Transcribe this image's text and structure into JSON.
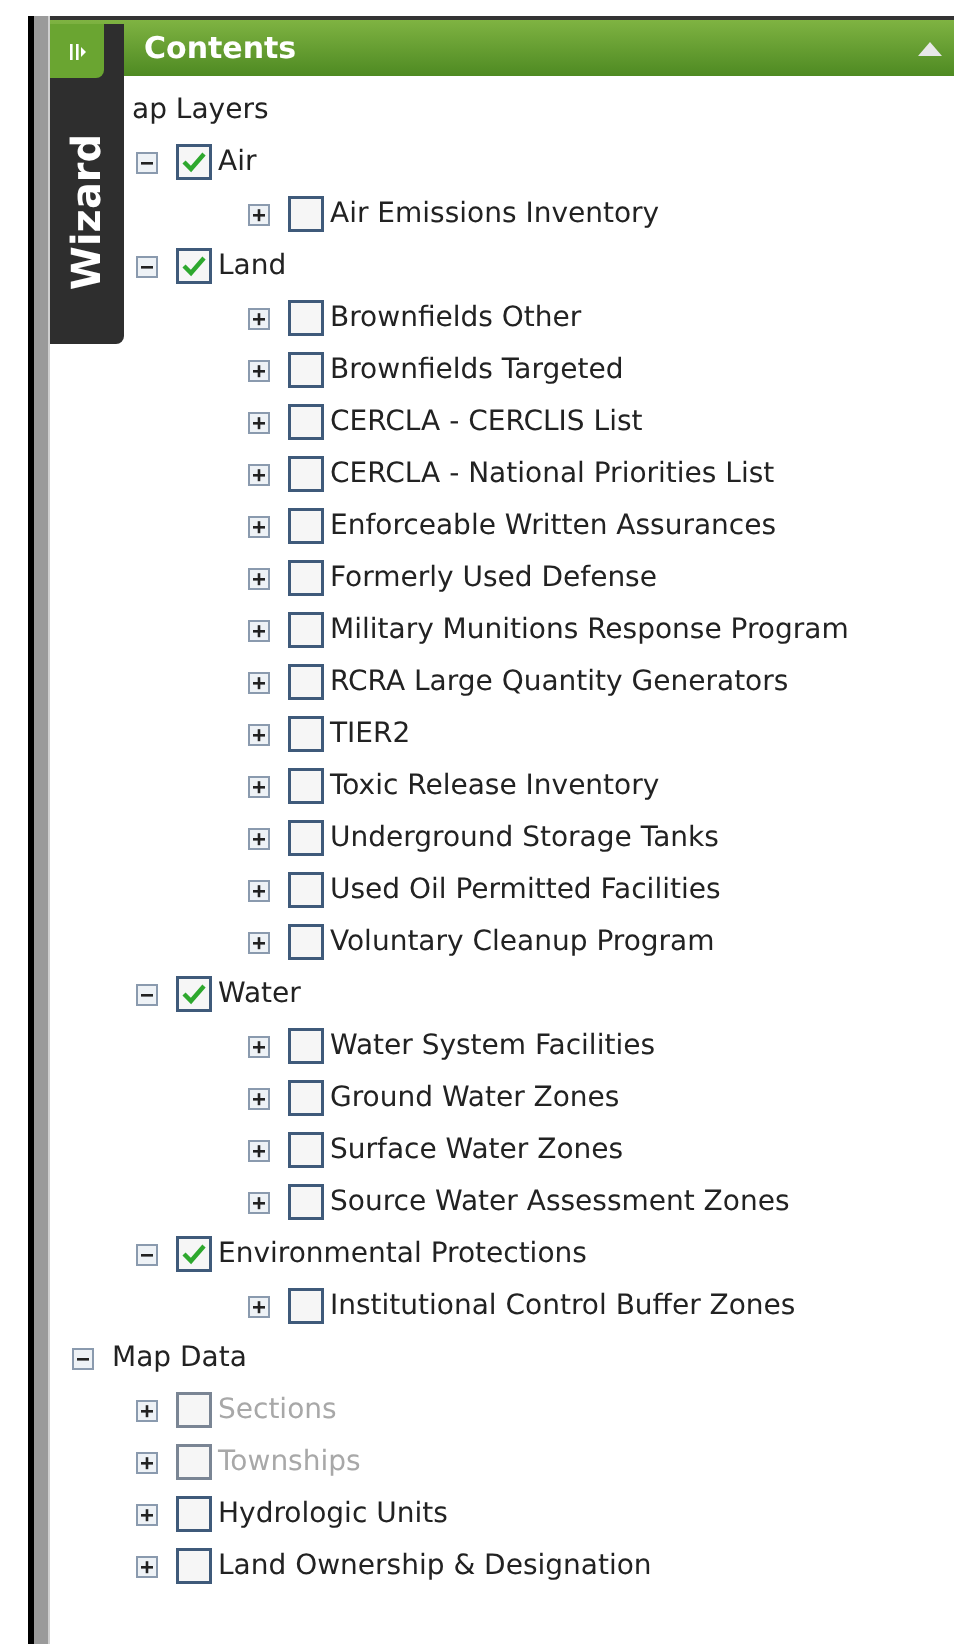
{
  "panel": {
    "title": "Contents"
  },
  "wizard": {
    "label": "Wizard"
  },
  "tree": [
    {
      "label": "ap Layers",
      "children": [
        {
          "label": "Air",
          "expanded": true,
          "checked": true,
          "disabled": false,
          "children": [
            {
              "label": "Air Emissions Inventory",
              "expanded": false,
              "checked": false,
              "disabled": false
            }
          ]
        },
        {
          "label": "Land",
          "expanded": true,
          "checked": true,
          "disabled": false,
          "children": [
            {
              "label": "Brownfields Other",
              "expanded": false,
              "checked": false,
              "disabled": false
            },
            {
              "label": "Brownfields Targeted",
              "expanded": false,
              "checked": false,
              "disabled": false
            },
            {
              "label": "CERCLA - CERCLIS List",
              "expanded": false,
              "checked": false,
              "disabled": false
            },
            {
              "label": "CERCLA - National Priorities List",
              "expanded": false,
              "checked": false,
              "disabled": false
            },
            {
              "label": "Enforceable Written Assurances",
              "expanded": false,
              "checked": false,
              "disabled": false
            },
            {
              "label": "Formerly Used Defense",
              "expanded": false,
              "checked": false,
              "disabled": false
            },
            {
              "label": "Military Munitions Response Program",
              "expanded": false,
              "checked": false,
              "disabled": false
            },
            {
              "label": "RCRA Large Quantity Generators",
              "expanded": false,
              "checked": false,
              "disabled": false
            },
            {
              "label": "TIER2",
              "expanded": false,
              "checked": false,
              "disabled": false
            },
            {
              "label": "Toxic Release Inventory",
              "expanded": false,
              "checked": false,
              "disabled": false
            },
            {
              "label": "Underground Storage Tanks",
              "expanded": false,
              "checked": false,
              "disabled": false
            },
            {
              "label": "Used Oil Permitted Facilities",
              "expanded": false,
              "checked": false,
              "disabled": false
            },
            {
              "label": "Voluntary Cleanup Program",
              "expanded": false,
              "checked": false,
              "disabled": false
            }
          ]
        },
        {
          "label": "Water",
          "expanded": true,
          "checked": true,
          "disabled": false,
          "children": [
            {
              "label": "Water System Facilities",
              "expanded": false,
              "checked": false,
              "disabled": false
            },
            {
              "label": "Ground Water Zones",
              "expanded": false,
              "checked": false,
              "disabled": false
            },
            {
              "label": "Surface Water Zones",
              "expanded": false,
              "checked": false,
              "disabled": false
            },
            {
              "label": "Source Water Assessment Zones",
              "expanded": false,
              "checked": false,
              "disabled": false
            }
          ]
        },
        {
          "label": "Environmental Protections",
          "expanded": true,
          "checked": true,
          "disabled": false,
          "children": [
            {
              "label": "Institutional Control Buffer Zones",
              "expanded": false,
              "checked": false,
              "disabled": false
            }
          ]
        }
      ]
    },
    {
      "label": "Map Data",
      "expanded": true,
      "children": [
        {
          "label": "Sections",
          "expanded": false,
          "checked": false,
          "disabled": true
        },
        {
          "label": "Townships",
          "expanded": false,
          "checked": false,
          "disabled": true
        },
        {
          "label": "Hydrologic Units",
          "expanded": false,
          "checked": false,
          "disabled": false
        },
        {
          "label": "Land Ownership & Designation",
          "expanded": false,
          "checked": false,
          "disabled": false
        }
      ]
    }
  ]
}
